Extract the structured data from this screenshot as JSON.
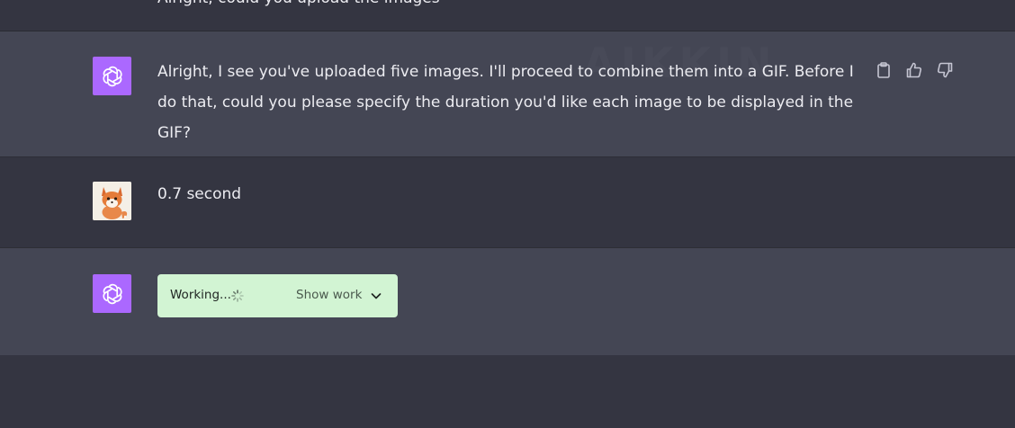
{
  "top": {
    "clipped_text": "Alright, could you upload the images"
  },
  "messages": [
    {
      "role": "assistant",
      "avatar_icon": "openai-logo-icon",
      "text": "Alright, I see you've uploaded five images. I'll proceed to combine them into a GIF. Before I do that, could you please specify the duration you'd like each image to be displayed in the GIF?",
      "watermark": "AIKKIN",
      "actions": [
        "copy-icon",
        "thumbs-up-icon",
        "thumbs-down-icon"
      ]
    },
    {
      "role": "user",
      "avatar_icon": "fox-avatar",
      "text": "0.7 second"
    },
    {
      "role": "assistant",
      "avatar_icon": "openai-logo-icon",
      "status": {
        "label": "Working...",
        "toggle_label": "Show work"
      }
    }
  ],
  "colors": {
    "page_bg": "#343541",
    "assistant_row_bg": "#444654",
    "gpt_avatar_bg": "#ab68ff",
    "working_box_bg": "#d2f4d3"
  }
}
